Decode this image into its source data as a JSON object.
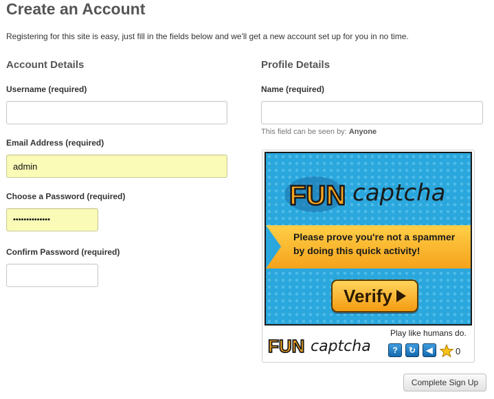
{
  "page": {
    "title": "Create an Account",
    "intro": "Registering for this site is easy, just fill in the fields below and we'll get a new account set up for you in no time."
  },
  "account": {
    "heading": "Account Details",
    "username_label": "Username (required)",
    "username_value": "",
    "email_label": "Email Address (required)",
    "email_value": "admin",
    "password_label": "Choose a Password (required)",
    "password_value": "••••••••••••••",
    "confirm_label": "Confirm Password (required)",
    "confirm_value": ""
  },
  "profile": {
    "heading": "Profile Details",
    "name_label": "Name (required)",
    "name_value": "",
    "visibility_prefix": "This field can be seen by:",
    "visibility_value": "Anyone"
  },
  "captcha": {
    "prompt_line1": "Please prove you're not a spammer",
    "prompt_line2": "by doing this quick activity!",
    "verify_label": "Verify",
    "logo_fun": "FUN",
    "logo_captcha": "captcha",
    "tagline": "Play like humans do.",
    "help_symbol": "?",
    "refresh_symbol": "↻",
    "audio_symbol": "◀",
    "star_count": "0"
  },
  "actions": {
    "submit_label": "Complete Sign Up"
  },
  "colors": {
    "filled_field": "#fafbb6",
    "captcha_blue": "#2aa7dd",
    "banner_orange": "#f5a21b"
  }
}
